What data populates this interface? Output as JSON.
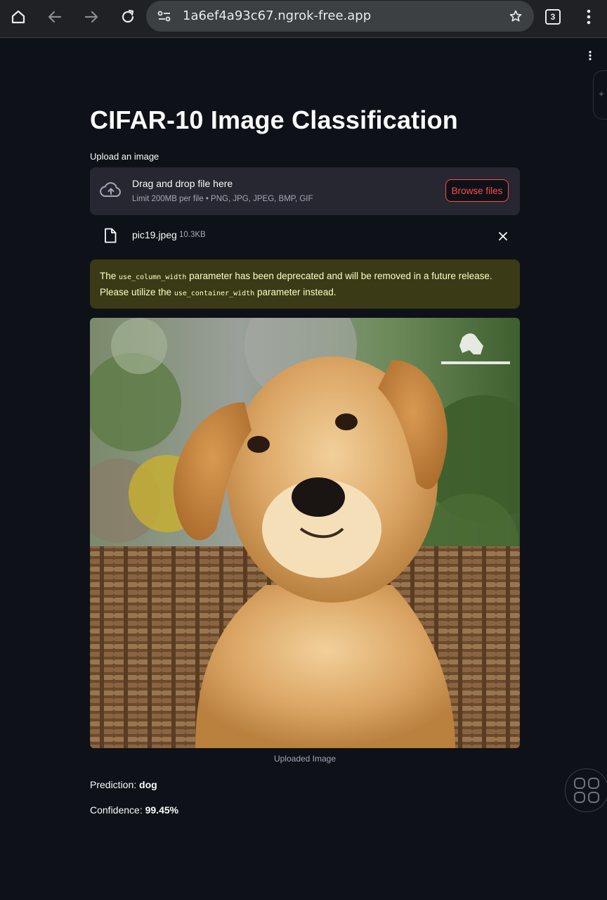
{
  "browser": {
    "url": "1a6ef4a93c67.ngrok-free.app",
    "tab_count": "3"
  },
  "app": {
    "title": "CIFAR-10 Image Classification",
    "uploader": {
      "label": "Upload an image",
      "drop_text": "Drag and drop file here",
      "limit_text": "Limit 200MB per file • PNG, JPG, JPEG, BMP, GIF",
      "browse_label": "Browse files"
    },
    "file": {
      "name": "pic19.jpeg",
      "size": "10.3KB"
    },
    "warning": {
      "part1": "The ",
      "code1": "use_column_width",
      "part2": " parameter has been deprecated and will be removed in a future release. Please utilize the ",
      "code2": "use_container_width",
      "part3": " parameter instead."
    },
    "image_caption": "Uploaded Image",
    "prediction_label": "Prediction: ",
    "prediction_value": "dog",
    "confidence_label": "Confidence: ",
    "confidence_value": "99.45%"
  },
  "colors": {
    "background": "#0e1117",
    "accent": "#ff4b4b",
    "warning_bg": "#3a3a17"
  }
}
